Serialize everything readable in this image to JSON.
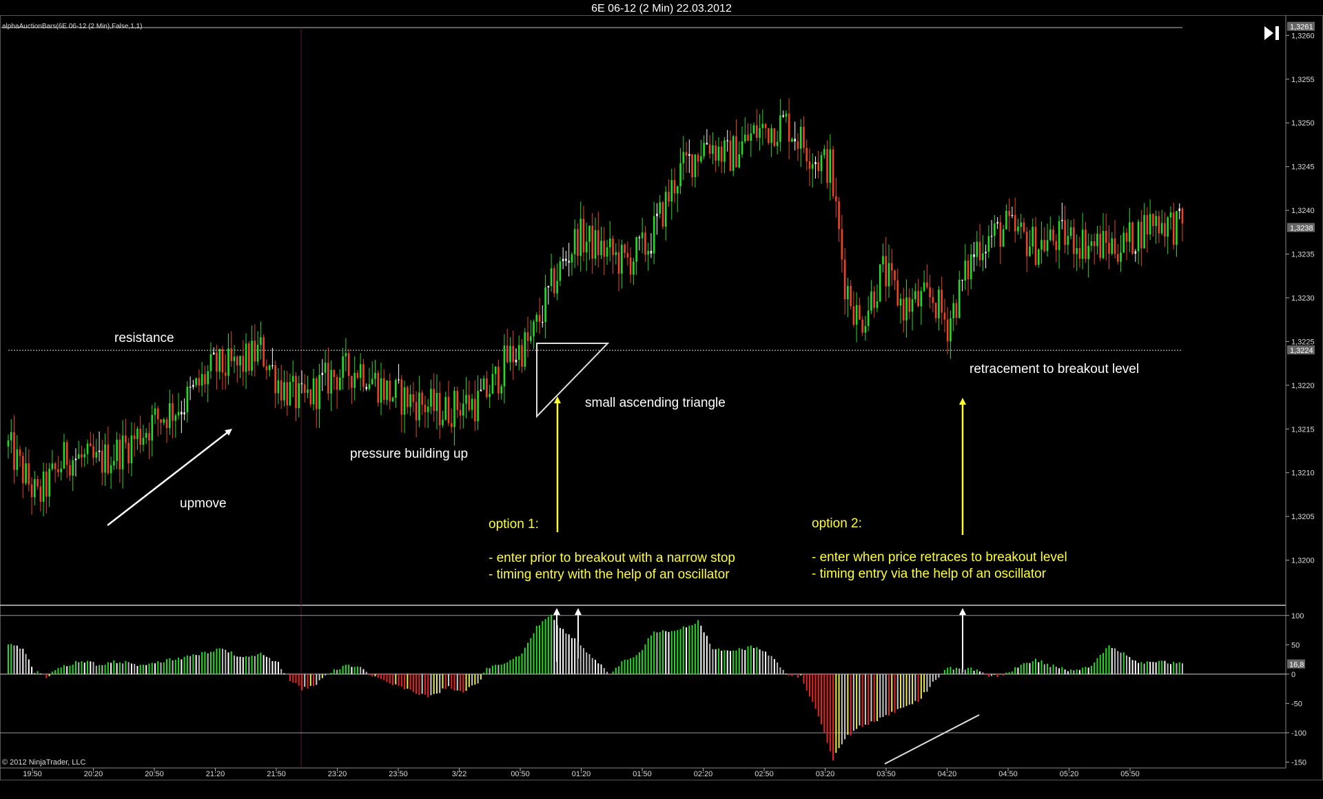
{
  "title": "6E 06-12 (2 Min)  22.03.2012",
  "indicator_label": "alphaAuctionBars(6E 06-12 (2 Min),False,1,1)",
  "copyright": "© 2012 NinjaTrader, LLC",
  "toolbar": {
    "end_icon": "skip-to-end-icon"
  },
  "colors": {
    "background": "#000000",
    "up": "#22dd22",
    "down": "#ee4422",
    "neutral": "#ffffff",
    "annotation": "#ffff33",
    "grid": "#888888"
  },
  "chart_data": [
    {
      "type": "candlestick",
      "ylim": [
        1.3195,
        1.3262
      ],
      "y_ticks": [
        "1,3200",
        "1,3205",
        "1,3210",
        "1,3215",
        "1,3220",
        "1,3225",
        "1,3230",
        "1,3235",
        "1,3240",
        "1,3245",
        "1,3250",
        "1,3255",
        "1,3260"
      ],
      "y_tick_values": [
        1.32,
        1.3205,
        1.321,
        1.3215,
        1.322,
        1.3225,
        1.323,
        1.3235,
        1.324,
        1.3245,
        1.325,
        1.3255,
        1.326
      ],
      "x_ticks": [
        "19:50",
        "20:20",
        "20:50",
        "21:20",
        "21:50",
        "23:20",
        "23:50",
        "3/22",
        "00:50",
        "01:20",
        "01:50",
        "02:20",
        "02:50",
        "03:20",
        "03:50",
        "04:20",
        "04:50",
        "05:20",
        "05:50"
      ],
      "price_markers": [
        {
          "label": "1,3261",
          "value": 1.3261
        },
        {
          "label": "1,3238",
          "value": 1.3238
        },
        {
          "label": "1,3224",
          "value": 1.3224
        }
      ],
      "resistance_level": 1.3224,
      "close_path": [
        [
          0,
          1.3213
        ],
        [
          10,
          1.3207
        ],
        [
          20,
          1.3212
        ],
        [
          30,
          1.3211
        ],
        [
          40,
          1.3213
        ],
        [
          50,
          1.3216
        ],
        [
          60,
          1.3218
        ],
        [
          70,
          1.3222
        ],
        [
          78,
          1.3222
        ],
        [
          86,
          1.3224
        ],
        [
          93,
          1.322
        ],
        [
          100,
          1.3218
        ],
        [
          110,
          1.3221
        ],
        [
          120,
          1.3222
        ],
        [
          130,
          1.3219
        ],
        [
          140,
          1.3218
        ],
        [
          148,
          1.3217
        ],
        [
          155,
          1.3218
        ],
        [
          160,
          1.3218
        ],
        [
          165,
          1.322
        ],
        [
          170,
          1.3223
        ],
        [
          178,
          1.3225
        ],
        [
          186,
          1.3232
        ],
        [
          194,
          1.3237
        ],
        [
          200,
          1.3236
        ],
        [
          210,
          1.3234
        ],
        [
          218,
          1.3236
        ],
        [
          228,
          1.3244
        ],
        [
          238,
          1.3248
        ],
        [
          245,
          1.3246
        ],
        [
          255,
          1.3249
        ],
        [
          265,
          1.325
        ],
        [
          275,
          1.3246
        ],
        [
          280,
          1.3245
        ],
        [
          285,
          1.3232
        ],
        [
          290,
          1.3227
        ],
        [
          298,
          1.3233
        ],
        [
          305,
          1.3229
        ],
        [
          315,
          1.323
        ],
        [
          320,
          1.3227
        ],
        [
          330,
          1.3236
        ],
        [
          340,
          1.3238
        ],
        [
          350,
          1.3236
        ],
        [
          360,
          1.3237
        ],
        [
          370,
          1.3236
        ],
        [
          380,
          1.3236
        ],
        [
          390,
          1.3239
        ],
        [
          400,
          1.3238
        ]
      ],
      "annotations": [
        "resistance",
        "upmove",
        "pressure building up",
        "small ascending triangle",
        "retracement to breakout level"
      ],
      "options": [
        {
          "title": "option 1:",
          "lines": [
            "- enter prior to breakout with a narrow stop",
            "- timing entry with the help of an oscillator"
          ]
        },
        {
          "title": "option 2:",
          "lines": [
            "- enter when price retraces  to breakout level",
            "- timing entry via the help of an oscillator"
          ]
        }
      ]
    },
    {
      "type": "bar",
      "name": "oscillator",
      "ylim": [
        -160,
        115
      ],
      "y_ticks": [
        "100",
        "50",
        "0",
        "-50",
        "-100",
        "-150"
      ],
      "y_tick_values": [
        100,
        50,
        0,
        -50,
        -100,
        -150
      ],
      "value_marker": "16,8",
      "reference_lines": [
        100,
        0,
        -100
      ],
      "value_path": [
        [
          0,
          52
        ],
        [
          5,
          42
        ],
        [
          9,
          5
        ],
        [
          13,
          -5
        ],
        [
          18,
          12
        ],
        [
          25,
          24
        ],
        [
          30,
          17
        ],
        [
          38,
          22
        ],
        [
          45,
          16
        ],
        [
          52,
          22
        ],
        [
          60,
          28
        ],
        [
          68,
          38
        ],
        [
          73,
          42
        ],
        [
          80,
          28
        ],
        [
          86,
          36
        ],
        [
          92,
          18
        ],
        [
          96,
          -10
        ],
        [
          100,
          -25
        ],
        [
          105,
          -18
        ],
        [
          110,
          5
        ],
        [
          115,
          15
        ],
        [
          120,
          10
        ],
        [
          125,
          -5
        ],
        [
          132,
          -20
        ],
        [
          138,
          -30
        ],
        [
          143,
          -40
        ],
        [
          150,
          -22
        ],
        [
          155,
          -30
        ],
        [
          160,
          -15
        ],
        [
          163,
          10
        ],
        [
          168,
          15
        ],
        [
          175,
          35
        ],
        [
          180,
          80
        ],
        [
          185,
          100
        ],
        [
          188,
          80
        ],
        [
          195,
          50
        ],
        [
          200,
          25
        ],
        [
          205,
          0
        ],
        [
          210,
          25
        ],
        [
          215,
          35
        ],
        [
          220,
          75
        ],
        [
          225,
          70
        ],
        [
          230,
          80
        ],
        [
          235,
          90
        ],
        [
          240,
          45
        ],
        [
          245,
          38
        ],
        [
          255,
          48
        ],
        [
          260,
          30
        ],
        [
          265,
          0
        ],
        [
          270,
          -5
        ],
        [
          275,
          -60
        ],
        [
          278,
          -100
        ],
        [
          281,
          -145
        ],
        [
          285,
          -110
        ],
        [
          290,
          -90
        ],
        [
          295,
          -80
        ],
        [
          300,
          -70
        ],
        [
          305,
          -55
        ],
        [
          310,
          -45
        ],
        [
          315,
          -15
        ],
        [
          320,
          10
        ],
        [
          330,
          8
        ],
        [
          335,
          -5
        ],
        [
          340,
          0
        ],
        [
          345,
          15
        ],
        [
          350,
          25
        ],
        [
          355,
          15
        ],
        [
          360,
          8
        ],
        [
          365,
          5
        ],
        [
          370,
          20
        ],
        [
          375,
          50
        ],
        [
          380,
          35
        ],
        [
          385,
          20
        ],
        [
          390,
          22
        ],
        [
          400,
          16.8
        ]
      ]
    }
  ]
}
